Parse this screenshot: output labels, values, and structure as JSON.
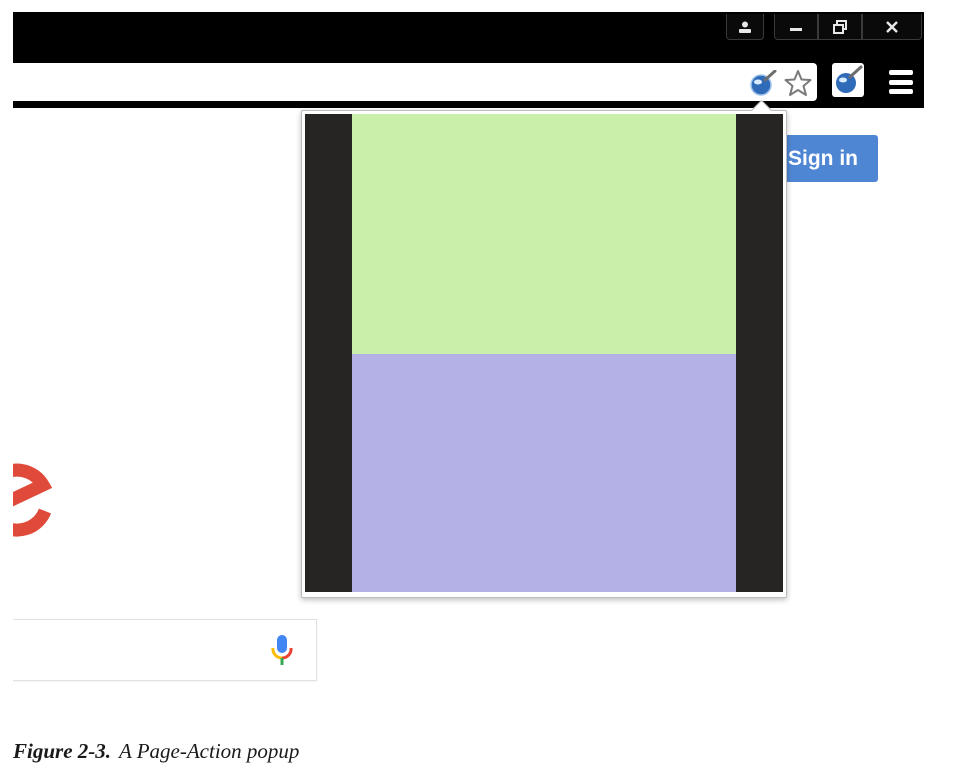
{
  "browser": {
    "signin_label": "Sign in",
    "window_controls": [
      "user-icon",
      "minimize-icon",
      "restore-icon",
      "close-icon"
    ],
    "page_action_icon": "page-action-icon",
    "bookmark_icon": "star-icon",
    "extension_icon": "extension-icon",
    "menu_icon": "hamburger-menu-icon"
  },
  "popup": {
    "top_color": "#c8f0aa",
    "bottom_color": "#b3b1e5",
    "frame_color": "#262524"
  },
  "colors": {
    "signin_button": "#4f86d4",
    "logo_red": "#e04a3a"
  },
  "caption": {
    "figure_label": "Figure 2-3.",
    "text": "A Page-Action popup"
  }
}
